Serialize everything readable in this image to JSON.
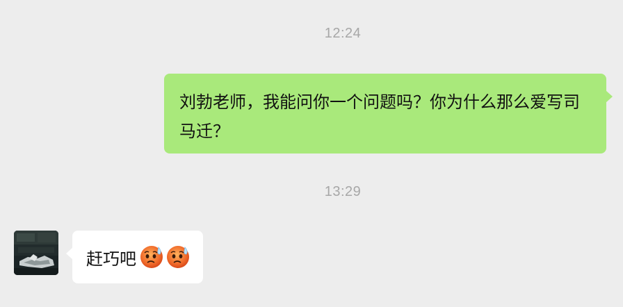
{
  "chat": {
    "messages": [
      {
        "type": "timestamp",
        "text": "12:24"
      },
      {
        "type": "sent",
        "text": "刘勃老师，我能问你一个问题吗？你为什么那么爱写司马迁？"
      },
      {
        "type": "timestamp",
        "text": "13:29"
      },
      {
        "type": "received",
        "text": "赶巧吧",
        "emojis": [
          "anxious-sweat-face-icon",
          "anxious-sweat-face-icon"
        ]
      }
    ]
  },
  "colors": {
    "background": "#ededed",
    "sent_bubble": "#a9e97b",
    "received_bubble": "#ffffff",
    "timestamp_text": "#a7a7a7"
  }
}
